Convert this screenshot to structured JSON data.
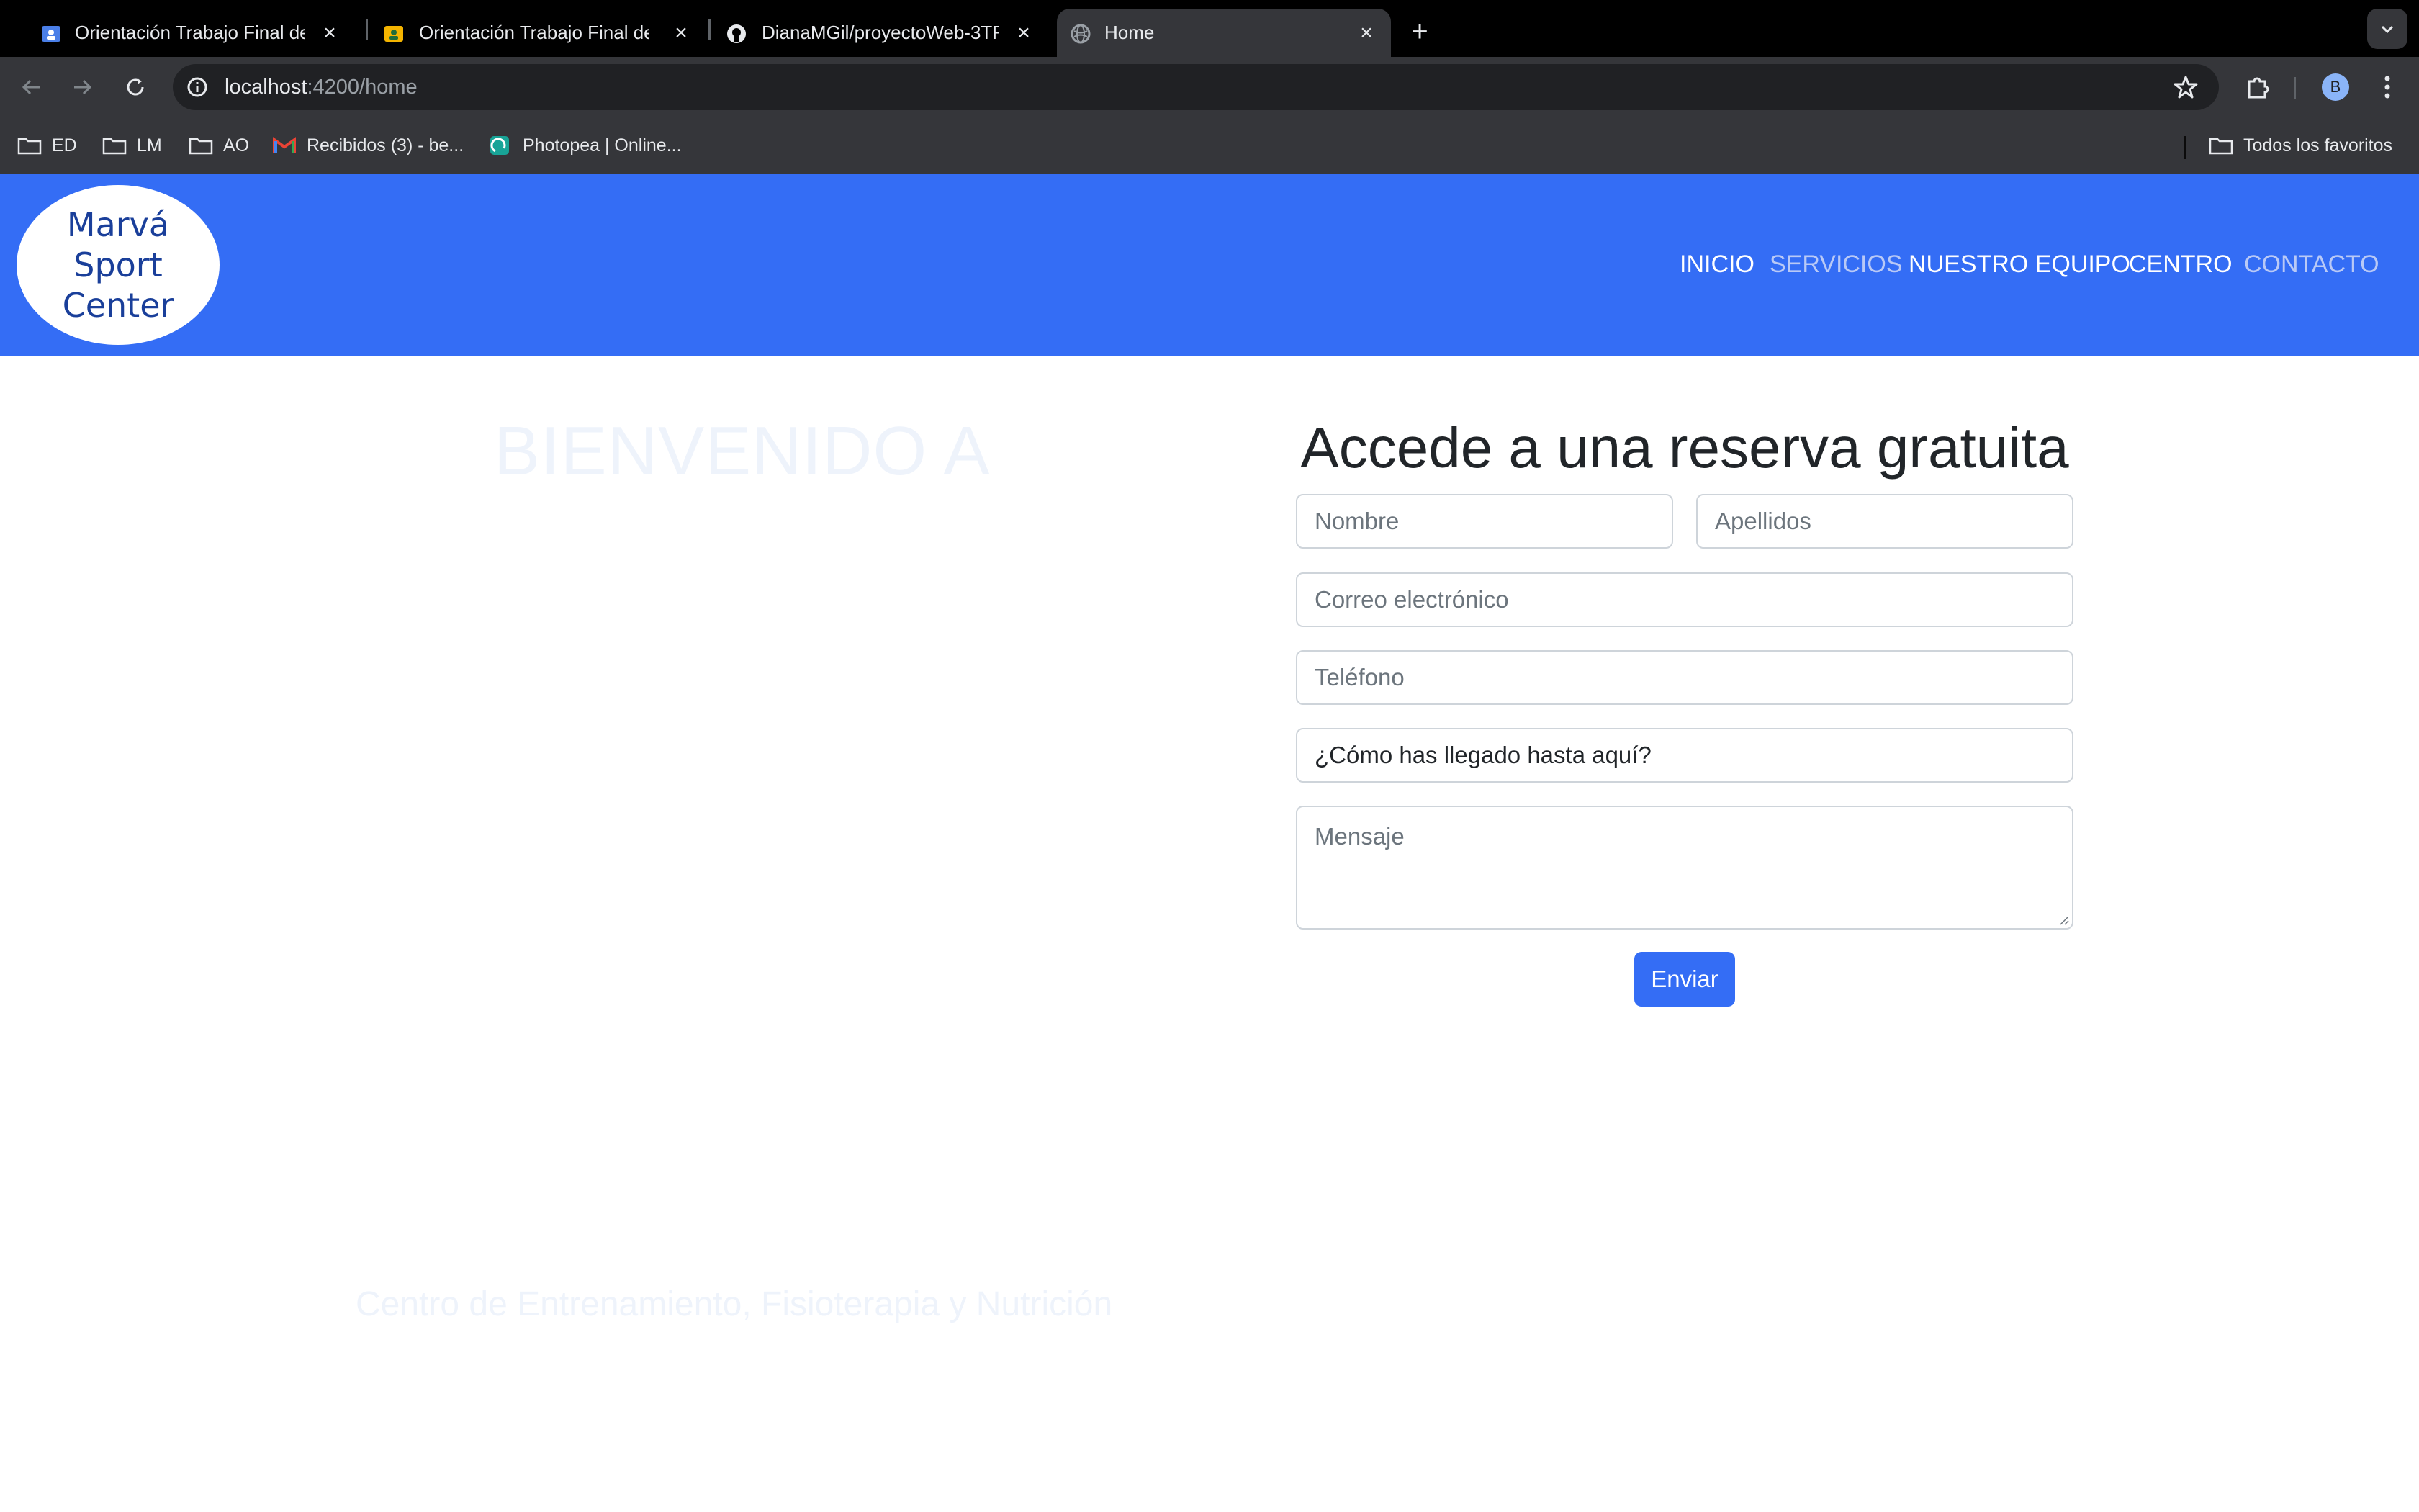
{
  "browser": {
    "tabs": [
      {
        "title": "Orientación Trabajo Final de 3",
        "icon": "classroom-icon",
        "active": false
      },
      {
        "title": "Orientación Trabajo Final de 3",
        "icon": "slides-icon",
        "active": false
      },
      {
        "title": "DianaMGil/proyectoWeb-3TRI",
        "icon": "github-icon",
        "active": false
      },
      {
        "title": "Home",
        "icon": "globe-icon",
        "active": true
      }
    ],
    "url_host": "localhost",
    "url_path": ":4200/home",
    "profile_initial": "B",
    "bookmarks": [
      {
        "label": "ED",
        "icon": "folder-icon"
      },
      {
        "label": "LM",
        "icon": "folder-icon"
      },
      {
        "label": "AO",
        "icon": "folder-icon"
      },
      {
        "label": "Recibidos (3) - be...",
        "icon": "gmail-icon"
      },
      {
        "label": "Photopea | Online...",
        "icon": "photopea-icon"
      }
    ],
    "all_bookmarks": "Todos los favoritos"
  },
  "site": {
    "logo_lines": [
      "Marvá",
      "Sport",
      "Center"
    ],
    "nav": [
      {
        "label": "INICIO",
        "state": "bright"
      },
      {
        "label": "SERVICIOS",
        "state": "muted"
      },
      {
        "label": "NUESTRO EQUIPO",
        "state": "bright"
      },
      {
        "label": "CENTRO",
        "state": "bright"
      },
      {
        "label": "CONTACTO",
        "state": "muted"
      }
    ],
    "brand_color": "#346df5"
  },
  "hero": {
    "welcome": "BIENVENIDO A",
    "tagline": "Centro de Entrenamiento, Fisioterapia y Nutrición"
  },
  "form": {
    "title": "Accede a una reserva gratuita",
    "nombre_placeholder": "Nombre",
    "apellidos_placeholder": "Apellidos",
    "email_placeholder": "Correo electrónico",
    "telefono_placeholder": "Teléfono",
    "origen_value": "¿Cómo has llegado hasta aquí?",
    "mensaje_placeholder": "Mensaje",
    "submit_label": "Enviar"
  }
}
